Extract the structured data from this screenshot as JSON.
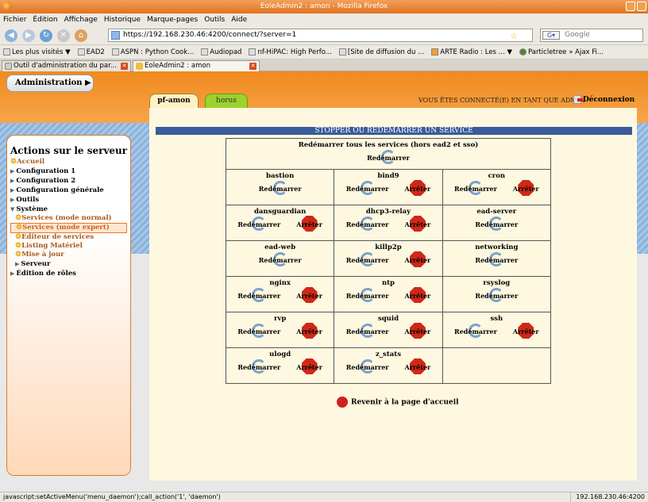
{
  "window": {
    "title": "EoleAdmin2 : amon - Mozilla Firefox"
  },
  "menubar": [
    "Fichier",
    "Édition",
    "Affichage",
    "Historique",
    "Marque-pages",
    "Outils",
    "Aide"
  ],
  "nav": {
    "url": "https://192.168.230.46:4200/connect/?server=1",
    "search_placeholder": "Google"
  },
  "bookmarks": [
    "Les plus visités ▼",
    "EAD2",
    "ASPN : Python Cook...",
    "Audiopad",
    "nf-HiPAC: High Perfo...",
    "[Site de diffusion du ...",
    "ARTE Radio : Les ... ▼",
    "Particletree » Ajax Fi..."
  ],
  "tabs": [
    {
      "label": "Outil d'administration du par..."
    },
    {
      "label": "EoleAdmin2 : amon"
    }
  ],
  "header": {
    "admin_menu": "Administration ▶",
    "tab_pf": "pf-amon",
    "tab_horus": "horus",
    "connected": "VOUS ÊTES CONNECTÉ(E) EN TANT QUE ADMIN",
    "logout": "Déconnexion"
  },
  "sidebar": {
    "title": "Actions sur le serveur",
    "items": {
      "accueil": "Accueil",
      "config1": "Configuration 1",
      "config2": "Configuration 2",
      "config_gen": "Configuration générale",
      "outils": "Outils",
      "systeme": "Système",
      "svc_normal": "Services (mode normal)",
      "svc_expert": "Services (mode expert)",
      "editeur": "Editeur de services",
      "listing": "Listing Matériel",
      "maj": "Mise à jour",
      "serveur": "Serveur",
      "roles": "Édition de rôles"
    }
  },
  "main": {
    "section_title": "STOPPER OU REDÉMARRER UN SERVICE",
    "restart_all": "Redémarrer tous les services (hors ead2 et sso)",
    "restart_label": "Redémarrer",
    "stop_label": "Arrêter",
    "services": [
      {
        "name": "bastion",
        "stop": false
      },
      {
        "name": "bind9",
        "stop": true
      },
      {
        "name": "cron",
        "stop": true
      },
      {
        "name": "dansguardian",
        "stop": true
      },
      {
        "name": "dhcp3-relay",
        "stop": true
      },
      {
        "name": "ead-server",
        "stop": false
      },
      {
        "name": "ead-web",
        "stop": false
      },
      {
        "name": "killp2p",
        "stop": true
      },
      {
        "name": "networking",
        "stop": false
      },
      {
        "name": "nginx",
        "stop": true
      },
      {
        "name": "ntp",
        "stop": true
      },
      {
        "name": "rsyslog",
        "stop": false
      },
      {
        "name": "rvp",
        "stop": true
      },
      {
        "name": "squid",
        "stop": true
      },
      {
        "name": "ssh",
        "stop": true
      },
      {
        "name": "ulogd",
        "stop": true
      },
      {
        "name": "z_stats",
        "stop": true
      }
    ],
    "back_link": "Revenir à la page d'accueil"
  },
  "statusbar": {
    "text": "javascript:setActiveMenu('menu_daemon');call_action('1', 'daemon')",
    "host": "192.168.230.46:4200"
  }
}
